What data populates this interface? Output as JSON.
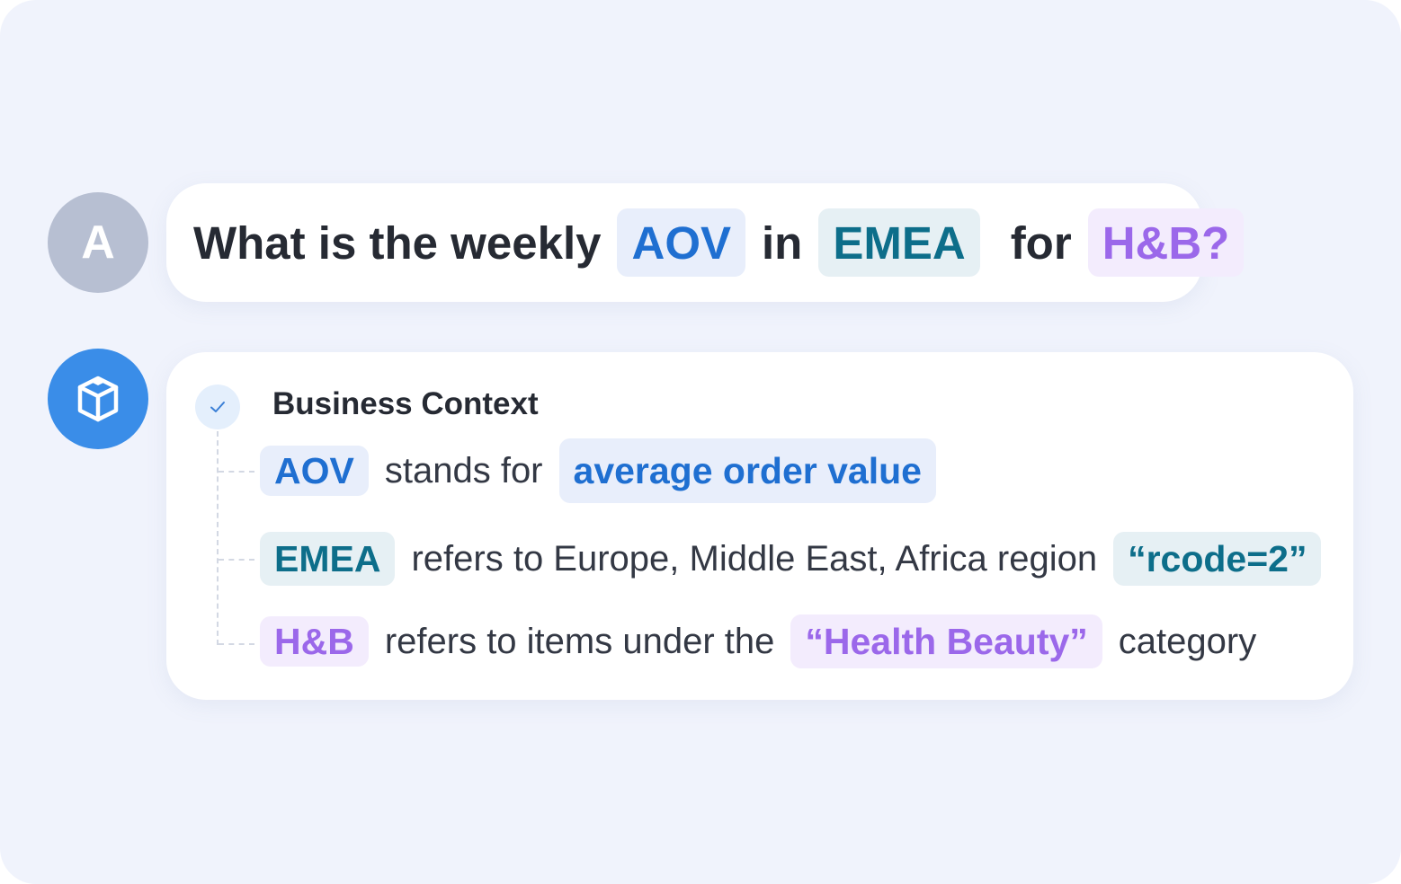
{
  "user_avatar": {
    "initial": "A"
  },
  "question": {
    "prefix": "What is the weekly",
    "term1": "AOV",
    "connector1": "in",
    "term2": "EMEA",
    "connector2": "for",
    "term3": "H&B?"
  },
  "answer": {
    "section_title": "Business Context",
    "rows": [
      {
        "term": "AOV",
        "text": "stands for",
        "value": "average order value",
        "suffix": ""
      },
      {
        "term": "EMEA",
        "text": "refers to Europe, Middle East,  Africa region",
        "value": "“rcode=2”",
        "suffix": ""
      },
      {
        "term": "H&B",
        "text": "refers to items under the",
        "value": "“Health Beauty”",
        "suffix": "category"
      }
    ]
  },
  "colors": {
    "background": "#f0f3fc",
    "blue_chip": "#1f6fd1",
    "teal_chip": "#0d6e8a",
    "purple_chip": "#9b68ea",
    "bot_avatar": "#3a8de8"
  },
  "icons": {
    "bot_avatar": "cube-icon",
    "section_status": "check-icon"
  }
}
